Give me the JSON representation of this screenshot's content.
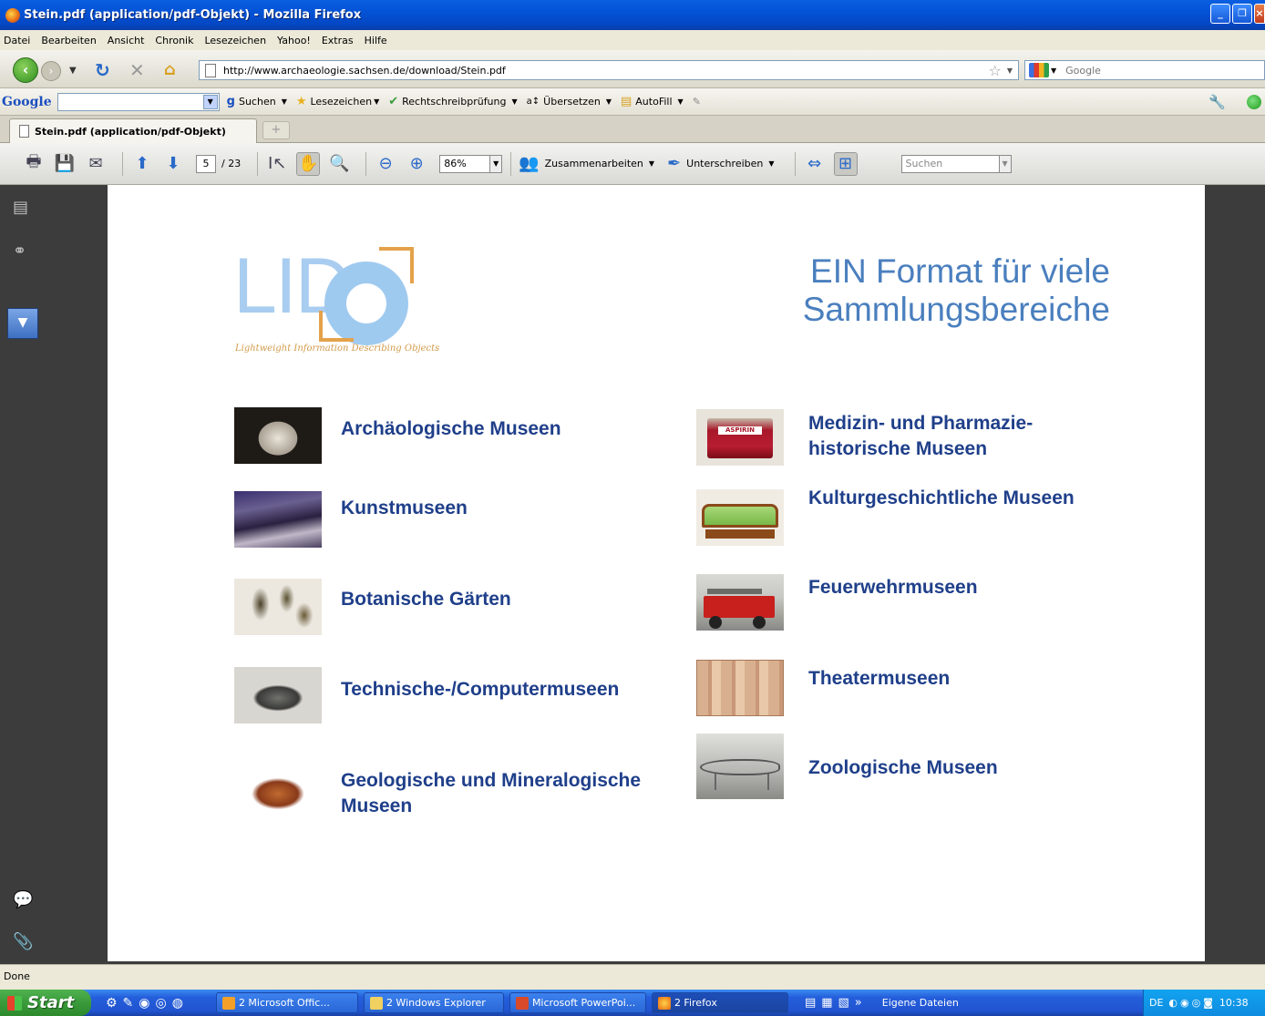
{
  "window": {
    "title": "Stein.pdf (application/pdf-Objekt) - Mozilla Firefox"
  },
  "menu": [
    "Datei",
    "Bearbeiten",
    "Ansicht",
    "Chronik",
    "Lesezeichen",
    "Yahoo!",
    "Extras",
    "Hilfe"
  ],
  "nav": {
    "url": "http://www.archaeologie.sachsen.de/download/Stein.pdf",
    "search_placeholder": "Google"
  },
  "google_toolbar": {
    "logo": "Google",
    "items": [
      "Suchen",
      "Lesezeichen",
      "Rechtschreibprüfung",
      "Übersetzen",
      "AutoFill"
    ]
  },
  "tabs": [
    {
      "label": "Stein.pdf (application/pdf-Objekt)"
    }
  ],
  "pdf_toolbar": {
    "page_current": "5",
    "page_total": "/ 23",
    "zoom": "86%",
    "collaborate_label": "Zusammenarbeiten",
    "sign_label": "Unterschreiben",
    "find_placeholder": "Suchen"
  },
  "slide": {
    "logo_letters": "LID",
    "logo_tagline": "Lightweight Information Describing Objects",
    "title_line1": "EIN Format für viele",
    "title_line2": "Sammlungsbereiche",
    "left_categories": [
      {
        "line1": "Archäologische Museen",
        "line2": ""
      },
      {
        "line1": "Kunstmuseen",
        "line2": ""
      },
      {
        "line1": "Botanische Gärten",
        "line2": ""
      },
      {
        "line1": "Technische-/Computermuseen",
        "line2": ""
      },
      {
        "line1": "Geologische und Mineralogische",
        "line2": "Museen"
      }
    ],
    "right_categories": [
      {
        "line1": "Medizin- und Pharmazie-",
        "line2": "historische Museen"
      },
      {
        "line1": "Kulturgeschichtliche Museen",
        "line2": ""
      },
      {
        "line1": "Feuerwehrmuseen",
        "line2": ""
      },
      {
        "line1": "Theatermuseen",
        "line2": ""
      },
      {
        "line1": "Zoologische Museen",
        "line2": ""
      }
    ],
    "aspirin_label": "ASPIRIN"
  },
  "status": "Done",
  "taskbar": {
    "start": "Start",
    "items": [
      "2 Microsoft Offic...",
      "2 Windows Explorer",
      "Microsoft PowerPoi...",
      "2 Firefox"
    ],
    "folder": "Eigene Dateien",
    "lang": "DE",
    "clock": "10:38"
  },
  "colors": {
    "title_blue": "#4a7fbe",
    "category_blue": "#1f3f8a",
    "logo_blue": "#9fcaf0",
    "logo_orange": "#e3a24a"
  }
}
